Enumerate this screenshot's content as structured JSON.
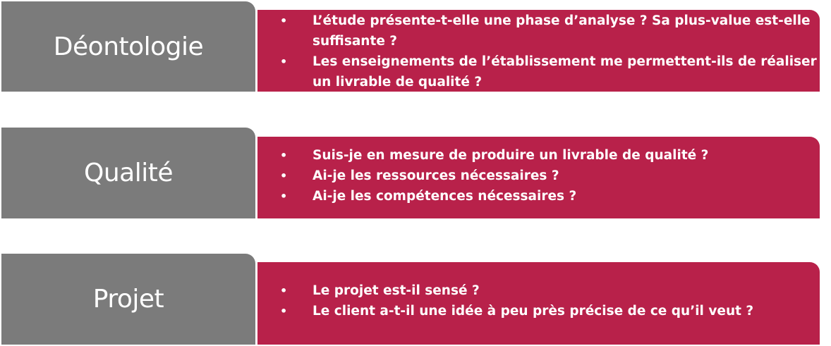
{
  "rows": [
    {
      "label": "Déontologie",
      "items": [
        "L’étude présente-t-elle une phase d’analyse ? Sa plus-value est-elle suffisante ?",
        "Les enseignements de l’établissement me permettent-ils de réaliser un livrable de qualité ?"
      ]
    },
    {
      "label": "Qualité",
      "items": [
        "Suis-je en mesure de produire un livrable de qualité ?",
        "Ai-je les ressources nécessaires ?",
        "Ai-je les compétences nécessaires ?"
      ]
    },
    {
      "label": "Projet",
      "items": [
        "Le projet est-il sensé ?",
        "Le client a-t-il une idée à peu près précise de ce qu’il veut ?"
      ]
    }
  ],
  "colors": {
    "label_bg": "#7b7b7b",
    "content_bg": "#b8214a",
    "text": "#ffffff"
  },
  "bullet_glyph": "•"
}
